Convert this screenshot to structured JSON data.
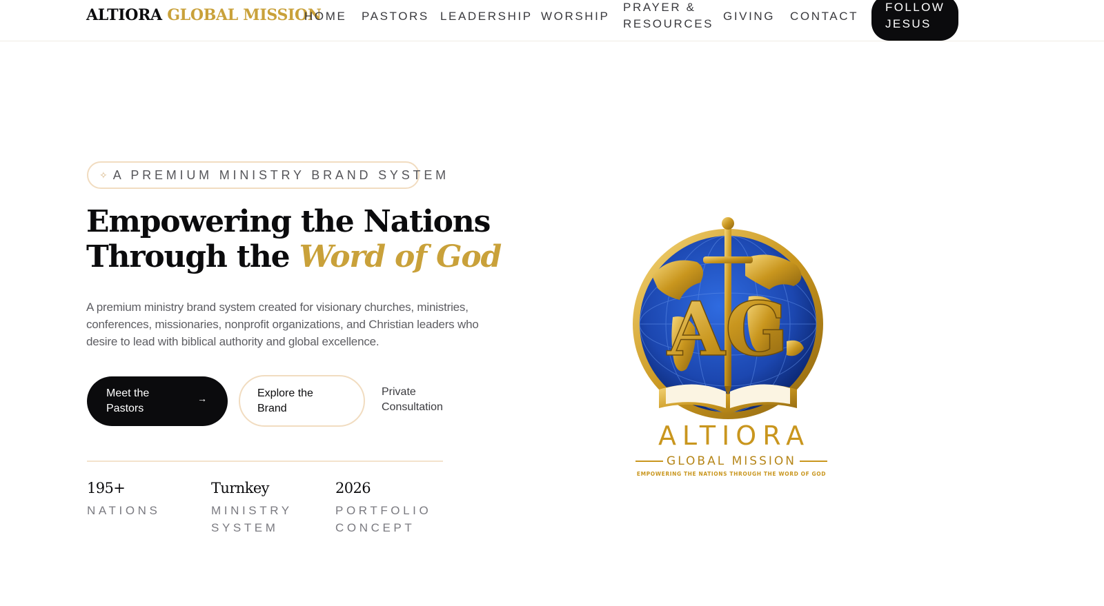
{
  "header": {
    "brand_part1": "ALTIORA",
    "brand_part2": "GLOBAL MISSION",
    "nav": [
      {
        "label": "HOME"
      },
      {
        "label": "PASTORS"
      },
      {
        "label": "LEADERSHIP"
      },
      {
        "label": "WORSHIP"
      },
      {
        "line1": "PRAYER &",
        "line2": "RESOURCES"
      },
      {
        "label": "GIVING"
      },
      {
        "label": "CONTACT"
      }
    ],
    "cta": {
      "line1": "FOLLOW",
      "line2": "JESUS"
    }
  },
  "hero": {
    "eyebrow": "A PREMIUM MINISTRY BRAND SYSTEM",
    "eyebrow_icon": "sparkle-icon",
    "title_line1": "Empowering the Nations",
    "title_line2_plain": "Through the",
    "title_line2_accent": "Word of God",
    "lead": "A premium ministry brand system created for visionary churches, ministries, conferences, missionaries, nonprofit organizations, and Christian leaders who desire to lead with biblical authority and global excellence.",
    "buttons": {
      "primary": "Meet the Pastors",
      "primary_icon": "arrow-right-icon",
      "secondary": "Explore the Brand",
      "tertiary": "Private Consultation"
    },
    "stats": [
      {
        "value": "195+",
        "label": "NATIONS"
      },
      {
        "value": "Turnkey",
        "label": "MINISTRY SYSTEM"
      },
      {
        "value": "2026",
        "label": "PORTFOLIO CONCEPT"
      }
    ]
  },
  "logo": {
    "monogram": "AG",
    "wordmark": "ALTIORA",
    "subtitle": "GLOBAL MISSION",
    "tagline": "EMPOWERING THE NATIONS THROUGH THE WORD OF GOD"
  },
  "colors": {
    "ink": "#0b0b0d",
    "gold": "#c9a13a",
    "blush": "#f1dcc0",
    "globe_blue": "#1c47b0"
  }
}
